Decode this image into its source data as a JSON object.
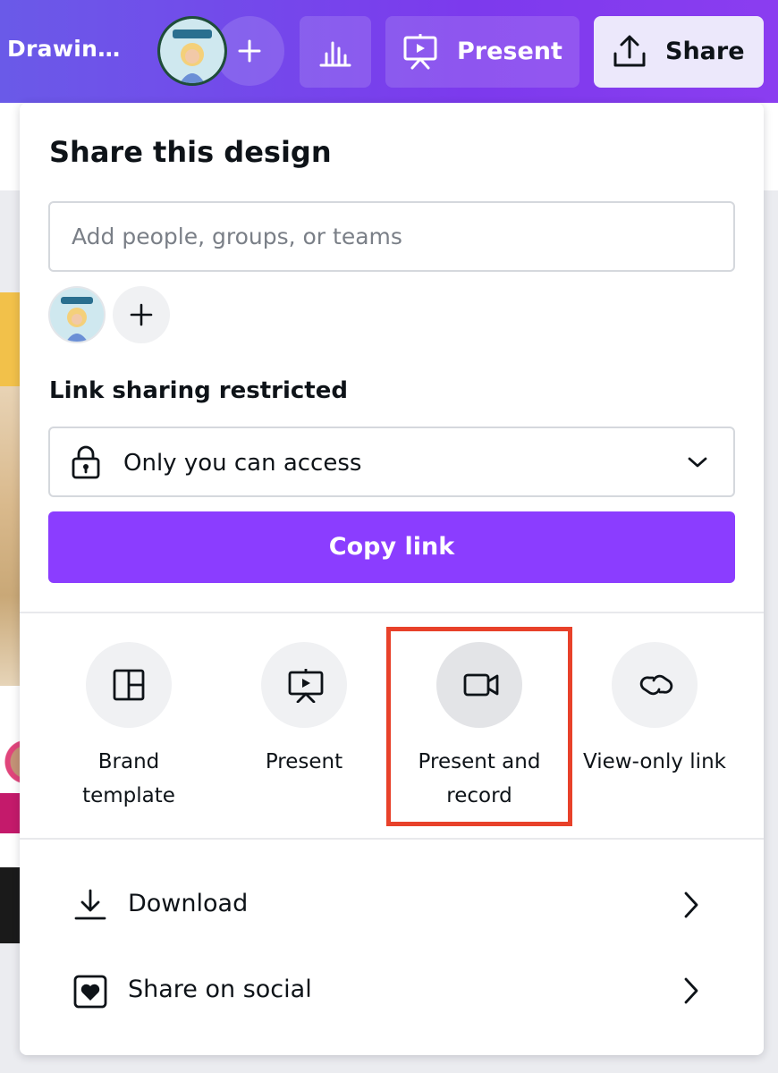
{
  "topbar": {
    "doc_title": "Drawin…",
    "present_label": "Present",
    "share_label": "Share",
    "icons": {
      "avatar": "user-avatar-icon",
      "add": "plus-icon",
      "insights": "bar-chart-icon",
      "present": "presentation-icon",
      "share": "upload-icon"
    }
  },
  "share_panel": {
    "title": "Share this design",
    "people_input_placeholder": "Add people, groups, or teams",
    "people_input_value": "",
    "link_sharing_heading": "Link sharing restricted",
    "access_selected": "Only you can access",
    "copy_link_label": "Copy link",
    "options": [
      {
        "label_line1": "Brand",
        "label_line2": "template",
        "icon": "layout-template-icon"
      },
      {
        "label_line1": "Present",
        "label_line2": "",
        "icon": "presentation-icon"
      },
      {
        "label_line1": "Present and",
        "label_line2": "record",
        "icon": "video-camera-icon"
      },
      {
        "label_line1": "View-only link",
        "label_line2": "",
        "icon": "link-icon"
      }
    ],
    "rows": [
      {
        "label": "Download",
        "icon": "download-icon"
      },
      {
        "label": "Share on social",
        "icon": "heart-icon"
      }
    ]
  },
  "colors": {
    "topbar_gradient_start": "#6a5ae8",
    "topbar_gradient_end": "#8b3df0",
    "primary_button": "#8b3dff",
    "highlight_box": "#e8412a"
  }
}
